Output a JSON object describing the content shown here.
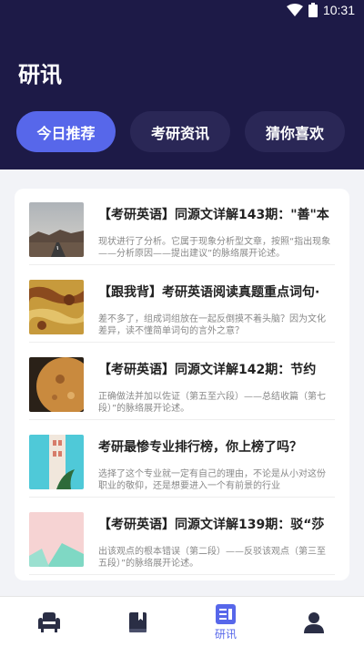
{
  "status_bar": {
    "time": "10:31"
  },
  "header": {
    "title": "研讯"
  },
  "tabs": [
    {
      "label": "今日推荐",
      "active": true
    },
    {
      "label": "考研资讯",
      "active": false
    },
    {
      "label": "猜你喜欢",
      "active": false
    }
  ],
  "articles": [
    {
      "title": "【考研英语】同源文详解143期：\"善\"本",
      "desc": "现状进行了分析。它属于现象分析型文章，按照“指出现象——分析原因——提出建议”的脉络展开论述。"
    },
    {
      "title": "【跟我背】考研英语阅读真题重点词句·",
      "desc": "差不多了，组成词组放在一起反倒摸不着头脑？因为文化差异，读不懂简单词句的言外之意？"
    },
    {
      "title": "【考研英语】同源文详解142期：节约",
      "desc": "正确做法并加以佐证（第五至六段）——总结收篇（第七段）”的脉络展开论述。"
    },
    {
      "title": "考研最惨专业排行榜，你上榜了吗？",
      "desc": "选择了这个专业就一定有自己的理由，不论是从小对这份职业的敬仰，还是想要进入一个有前景的行业"
    },
    {
      "title": "【考研英语】同源文详解139期：驳“莎",
      "desc": "出该观点的根本错误（第二段）——反驳该观点（第三至五段）”的脉络展开论述。"
    }
  ],
  "bottom_nav": [
    {
      "label": "",
      "icon": "armchair-icon",
      "active": false
    },
    {
      "label": "",
      "icon": "book-icon",
      "active": false
    },
    {
      "label": "研讯",
      "icon": "news-icon",
      "active": true
    },
    {
      "label": "",
      "icon": "person-icon",
      "active": false
    }
  ],
  "colors": {
    "header_bg": "#1d1a47",
    "accent": "#5767ea",
    "tab_bg": "#2a2756"
  }
}
